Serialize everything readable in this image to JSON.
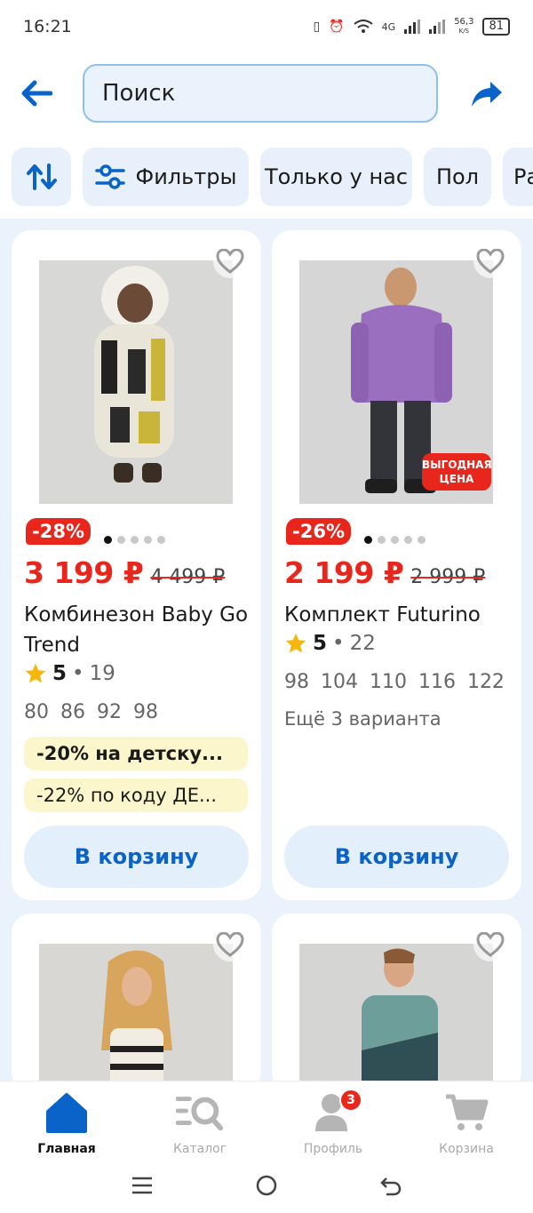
{
  "status_bar": {
    "time": "16:21",
    "net": "4G",
    "speed": "56,3",
    "speed_unit": "K/S",
    "battery": "81"
  },
  "search": {
    "placeholder": "Поиск"
  },
  "chips": [
    "Фильтры",
    "Только у нас",
    "Пол",
    "Ра"
  ],
  "products": [
    {
      "discount": "-28%",
      "price": "3 199 ₽",
      "old_price": "4 499 ₽",
      "title": "Комбинезон Baby Go Trend",
      "rating": "5",
      "reviews": "19",
      "sizes": "80 86 92 98",
      "promo1": "-20% на детску...",
      "promo2": "-22% по коду ДЕ...",
      "cart": "В корзину"
    },
    {
      "discount": "-26%",
      "price": "2 199 ₽",
      "old_price": "2 999 ₽",
      "badge_line1": "ВЫГОДНАЯ",
      "badge_line2": "ЦЕНА",
      "title": "Комплект Futurino",
      "rating": "5",
      "reviews": "22",
      "sizes": "98 104 110 116 122",
      "variants": "Ещё 3 варианта",
      "cart": "В корзину"
    }
  ],
  "bottom_nav": {
    "home": "Главная",
    "catalog": "Каталог",
    "profile": "Профиль",
    "profile_badge": "3",
    "cart": "Корзина"
  },
  "colors": {
    "accent": "#0a63c9",
    "sale": "#e8261c",
    "chip_bg": "#e8f1fb",
    "promo_bg": "#fcf6cd"
  }
}
